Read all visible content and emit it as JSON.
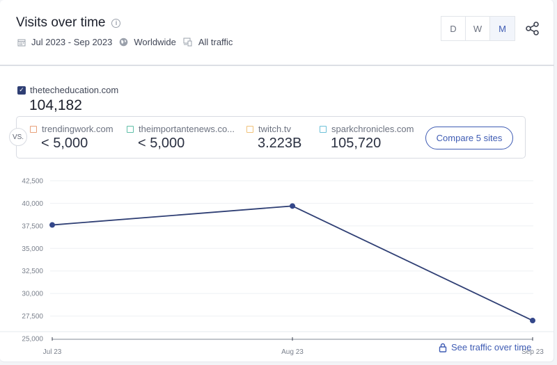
{
  "header": {
    "title": "Visits over time",
    "info_icon": "info-icon",
    "date_range": "Jul 2023 - Sep 2023",
    "region": "Worldwide",
    "traffic_type": "All traffic",
    "granularity": [
      {
        "label": "D",
        "active": false
      },
      {
        "label": "W",
        "active": false
      },
      {
        "label": "M",
        "active": true
      }
    ]
  },
  "main_site": {
    "domain": "thetecheducation.com",
    "checked": true,
    "value": "104,182"
  },
  "compare": {
    "vs_label": "VS.",
    "sites": [
      {
        "domain": "trendingwork.com",
        "value": "< 5,000",
        "color": "#e8a07a"
      },
      {
        "domain": "theimportantenews.co...",
        "value": "< 5,000",
        "color": "#5fbfa8"
      },
      {
        "domain": "twitch.tv",
        "value": "3.223B",
        "color": "#f0c27a"
      },
      {
        "domain": "sparkchronicles.com",
        "value": "105,720",
        "color": "#6cc0d8"
      }
    ],
    "button_label": "Compare 5 sites"
  },
  "footer": {
    "link_label": "See traffic over time"
  },
  "colors": {
    "line": "#2f3f74",
    "accent": "#3e5bb3"
  },
  "chart_data": {
    "type": "line",
    "title": "Visits over time",
    "xlabel": "",
    "ylabel": "",
    "categories": [
      "Jul 23",
      "Aug 23",
      "Sep 23"
    ],
    "series": [
      {
        "name": "thetecheducation.com",
        "values": [
          37600,
          39700,
          27000
        ]
      }
    ],
    "ylim": [
      25000,
      42500
    ],
    "yticks": [
      25000,
      27500,
      30000,
      32500,
      35000,
      37500,
      40000,
      42500
    ],
    "ytick_labels": [
      "25,000",
      "27,500",
      "30,000",
      "32,500",
      "35,000",
      "37,500",
      "40,000",
      "42,500"
    ],
    "grid": true,
    "legend": "none"
  }
}
